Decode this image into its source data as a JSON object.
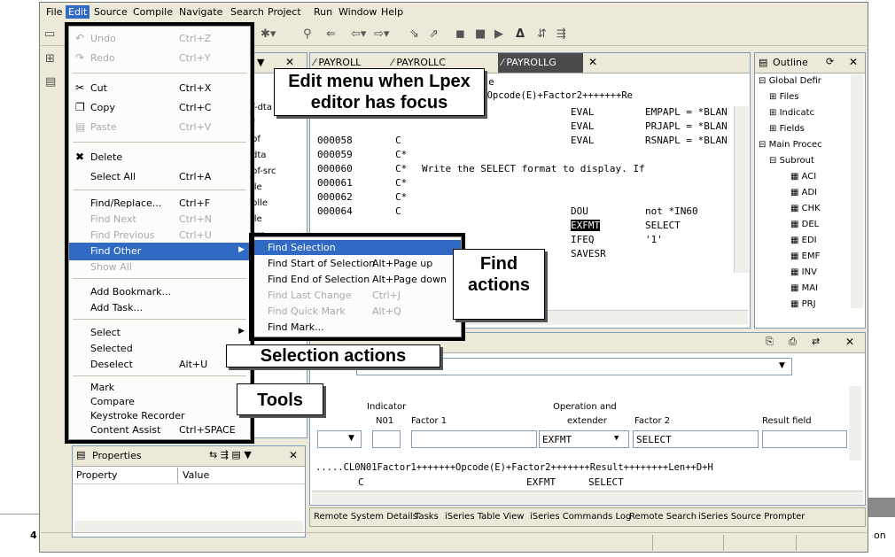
{
  "menubar": [
    "File",
    "Edit",
    "Source",
    "Compile",
    "Navigate",
    "Search",
    "Project",
    "Run",
    "Window",
    "Help"
  ],
  "edit_menu": [
    {
      "label": "Undo",
      "shortcut": "Ctrl+Z",
      "icon": "undo-icon",
      "disabled": true
    },
    {
      "label": "Redo",
      "shortcut": "Ctrl+Y",
      "icon": "redo-icon",
      "disabled": true
    },
    {
      "label": "Cut",
      "shortcut": "Ctrl+X",
      "icon": "cut-icon",
      "disabled": false
    },
    {
      "label": "Copy",
      "shortcut": "Ctrl+C",
      "icon": "copy-icon",
      "disabled": false
    },
    {
      "label": "Paste",
      "shortcut": "Ctrl+V",
      "icon": "paste-icon",
      "disabled": true
    },
    {
      "label": "Delete",
      "shortcut": "",
      "icon": "delete-icon",
      "disabled": false
    },
    {
      "label": "Select All",
      "shortcut": "Ctrl+A",
      "disabled": false
    },
    {
      "label": "Find/Replace...",
      "shortcut": "Ctrl+F",
      "disabled": false
    },
    {
      "label": "Find Next",
      "shortcut": "Ctrl+N",
      "disabled": true
    },
    {
      "label": "Find Previous",
      "shortcut": "Ctrl+U",
      "disabled": true
    },
    {
      "label": "Find Other",
      "shortcut": "",
      "disabled": false,
      "submenu": true
    },
    {
      "label": "Show All",
      "shortcut": "",
      "disabled": true
    },
    {
      "label": "Add Bookmark...",
      "shortcut": "",
      "disabled": false
    },
    {
      "label": "Add Task...",
      "shortcut": "",
      "disabled": false
    },
    {
      "label": "Select",
      "shortcut": "",
      "disabled": false,
      "submenu": true
    },
    {
      "label": "Selected",
      "shortcut": "",
      "disabled": false
    },
    {
      "label": "Deselect",
      "shortcut": "Alt+U",
      "disabled": false
    },
    {
      "label": "Mark",
      "shortcut": "",
      "disabled": false
    },
    {
      "label": "Compare",
      "shortcut": "",
      "disabled": false
    },
    {
      "label": "Keystroke Recorder",
      "shortcut": "",
      "disabled": false
    },
    {
      "label": "Content Assist",
      "shortcut": "Ctrl+SPACE",
      "disabled": false
    }
  ],
  "find_submenu": [
    {
      "label": "Find Selection",
      "shortcut": "",
      "disabled": false
    },
    {
      "label": "Find Start of Selection",
      "shortcut": "Alt+Page up",
      "disabled": false
    },
    {
      "label": "Find End of Selection",
      "shortcut": "Alt+Page down",
      "disabled": false
    },
    {
      "label": "Find Last Change",
      "shortcut": "Ctrl+J",
      "disabled": true
    },
    {
      "label": "Find Quick Mark",
      "shortcut": "Alt+Q",
      "disabled": true
    },
    {
      "label": "Find Mark...",
      "shortcut": "",
      "disabled": false
    }
  ],
  "callouts": {
    "edit_menu": "Edit menu when Lpex editor has focus",
    "find_actions": "Find actions",
    "selection_actions": "Selection actions",
    "tools": "Tools"
  },
  "left_list": [
    "f-dta",
    "f",
    "pf",
    "dta",
    "pf-src",
    "lle",
    "blle",
    "lle",
    "src"
  ],
  "editor_tabs": [
    "PAYROLL",
    "PAYROLLC",
    "PAYROLLG"
  ],
  "editor_header_a": "eplace",
  "editor_header_b": "+++++Opcode(E)+Factor2+++++++Re",
  "code_lines": [
    {
      "ln": "",
      "c": "",
      "t": "",
      "o": "EVAL",
      "r": "EMPAPL = *BLAN"
    },
    {
      "ln": "",
      "c": "",
      "t": "",
      "o": "EVAL",
      "r": "PRJAPL = *BLAN"
    },
    {
      "ln": "000058",
      "c": "C",
      "t": "",
      "o": "EVAL",
      "r": "RSNAPL = *BLAN"
    },
    {
      "ln": "000059",
      "c": "C*",
      "t": "",
      "o": "",
      "r": ""
    },
    {
      "ln": "000060",
      "c": "C*",
      "t": "Write the SELECT format to display.  If",
      "o": "",
      "r": ""
    },
    {
      "ln": "000061",
      "c": "C*",
      "t": "",
      "o": "",
      "r": ""
    },
    {
      "ln": "000062",
      "c": "C*",
      "t": "",
      "o": "",
      "r": ""
    },
    {
      "ln": "000064",
      "c": "C",
      "t": "",
      "o": "DOU",
      "r": "not *IN60"
    },
    {
      "ln": "",
      "c": "",
      "t": "",
      "o": "EXFMT",
      "r": "SELECT"
    },
    {
      "ln": "",
      "c": "",
      "t": "",
      "o": "IFEQ",
      "r": "'1'"
    },
    {
      "ln": "",
      "c": "",
      "t": "",
      "o": "SAVESR",
      "r": ""
    }
  ],
  "outline": {
    "tab": "Outline",
    "items": [
      "Global Defir",
      "Files",
      "Indicatc",
      "Fields",
      "Main Procec",
      "Subrout",
      "ACI",
      "ADI",
      "CHK",
      "DEL",
      "EDI",
      "EMF",
      "INV",
      "MAI",
      "PRJ"
    ]
  },
  "prompter": {
    "line_type_label": "Line type:",
    "line_type_value": "CF Calculation",
    "indicator_label": "Indicator",
    "n01_label": "N01",
    "factor1_label": "Factor 1",
    "operation_label": "Operation and",
    "extender_label": "extender",
    "factor2_label": "Factor 2",
    "result_label": "Result field",
    "operation_value": "EXFMT",
    "factor2_value": "SELECT",
    "ruler": ".....CL0N01Factor1+++++++Opcode(E)+Factor2+++++++Result++++++++Len++D+H",
    "code_c": "C",
    "code_op": "EXFMT",
    "code_f2": "SELECT"
  },
  "properties": {
    "title": "Properties",
    "col_property": "Property",
    "col_value": "Value"
  },
  "bottom_tabs": [
    "Remote System Details",
    "Tasks",
    "iSeries Table View",
    "iSeries Commands Log",
    "Remote Search",
    "iSeries Source Prompter"
  ],
  "page_left_number": "4",
  "page_right_text": "on"
}
